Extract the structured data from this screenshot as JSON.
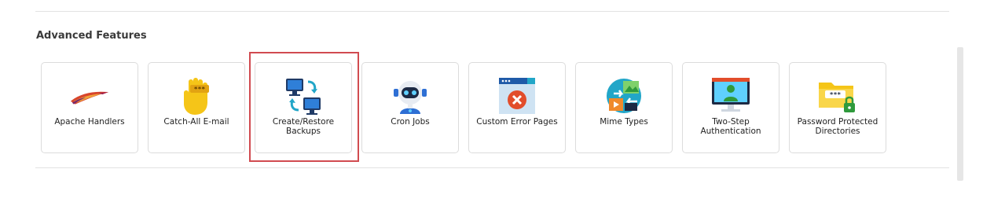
{
  "section": {
    "title": "Advanced Features"
  },
  "tiles": [
    {
      "label": "Apache Handlers",
      "icon": "apache-feather-icon"
    },
    {
      "label": "Catch-All E-mail",
      "icon": "raised-hand-icon"
    },
    {
      "label": "Create/Restore Backups",
      "icon": "backup-computers-icon"
    },
    {
      "label": "Cron Jobs",
      "icon": "robot-icon"
    },
    {
      "label": "Custom Error Pages",
      "icon": "error-page-icon"
    },
    {
      "label": "Mime Types",
      "icon": "mime-types-icon"
    },
    {
      "label": "Two-Step Authentication",
      "icon": "two-step-auth-icon"
    },
    {
      "label": "Password Protected Directories",
      "icon": "locked-folder-icon"
    }
  ],
  "highlight": {
    "target": "Create/Restore Backups",
    "color": "#d14b50"
  },
  "colors": {
    "border": "#dcdcdc",
    "text": "#222222"
  }
}
